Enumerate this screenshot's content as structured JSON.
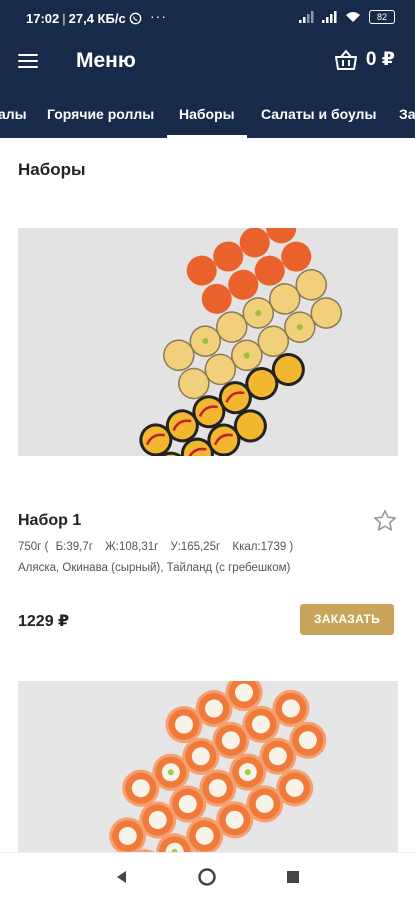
{
  "status_bar": {
    "time": "17:02",
    "separator": "|",
    "speed": "27,4 КБ/с",
    "dots": "···",
    "battery": "82",
    "icons": [
      "whatsapp-icon",
      "signal-icon",
      "signal-icon",
      "wifi-icon",
      "battery-icon"
    ]
  },
  "app_bar": {
    "title": "Меню",
    "cart_total": "0 ₽"
  },
  "tabs": [
    {
      "label": "алы"
    },
    {
      "label": "Горячие роллы"
    },
    {
      "label": "Наборы",
      "active": true
    },
    {
      "label": "Салаты и боулы"
    },
    {
      "label": "За"
    }
  ],
  "section": {
    "title": "Наборы"
  },
  "products": [
    {
      "name": "Набор 1",
      "weight": "750г (",
      "proteins": "Б:39,7г",
      "fats": "Ж:108,31г",
      "carbs": "У:165,25г",
      "kcal": "Ккал:1739 )",
      "composition": "Аляска, Окинава (сырный), Тайланд (с гребешком)",
      "price": "1229 ₽",
      "order_label": "ЗАКАЗАТЬ"
    }
  ],
  "colors": {
    "primary": "#172a4a",
    "accent": "#c9a55b",
    "image_bg": "#e4e4e4"
  }
}
